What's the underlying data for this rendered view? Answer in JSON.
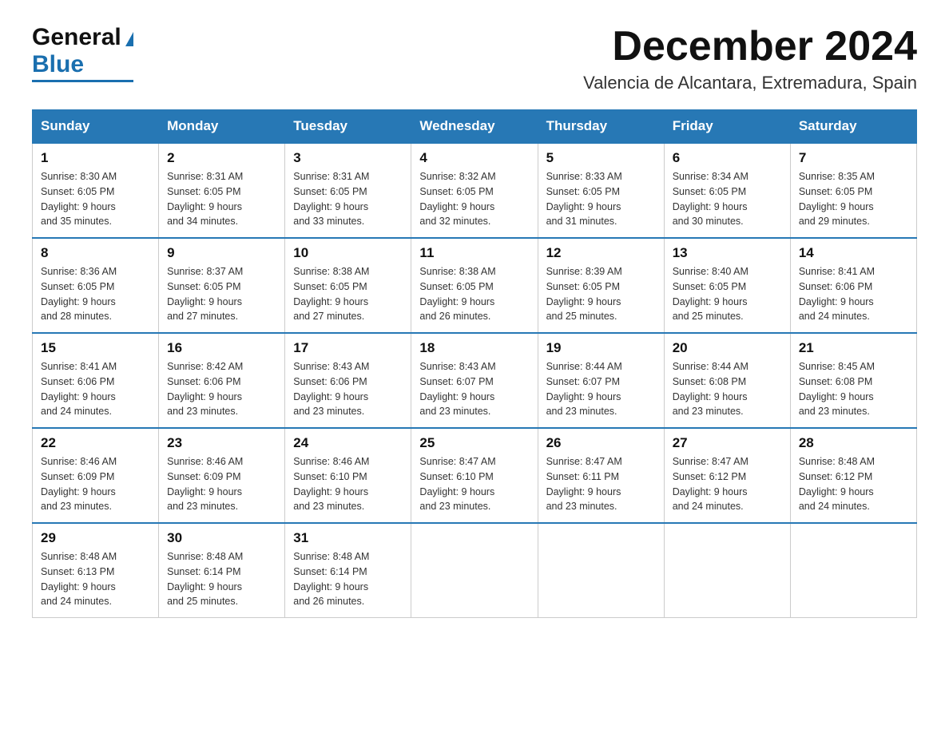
{
  "header": {
    "logo_general": "General",
    "logo_blue": "Blue",
    "month_title": "December 2024",
    "location": "Valencia de Alcantara, Extremadura, Spain"
  },
  "days_of_week": [
    "Sunday",
    "Monday",
    "Tuesday",
    "Wednesday",
    "Thursday",
    "Friday",
    "Saturday"
  ],
  "weeks": [
    [
      {
        "day": "1",
        "sunrise": "8:30 AM",
        "sunset": "6:05 PM",
        "daylight": "9 hours and 35 minutes."
      },
      {
        "day": "2",
        "sunrise": "8:31 AM",
        "sunset": "6:05 PM",
        "daylight": "9 hours and 34 minutes."
      },
      {
        "day": "3",
        "sunrise": "8:31 AM",
        "sunset": "6:05 PM",
        "daylight": "9 hours and 33 minutes."
      },
      {
        "day": "4",
        "sunrise": "8:32 AM",
        "sunset": "6:05 PM",
        "daylight": "9 hours and 32 minutes."
      },
      {
        "day": "5",
        "sunrise": "8:33 AM",
        "sunset": "6:05 PM",
        "daylight": "9 hours and 31 minutes."
      },
      {
        "day": "6",
        "sunrise": "8:34 AM",
        "sunset": "6:05 PM",
        "daylight": "9 hours and 30 minutes."
      },
      {
        "day": "7",
        "sunrise": "8:35 AM",
        "sunset": "6:05 PM",
        "daylight": "9 hours and 29 minutes."
      }
    ],
    [
      {
        "day": "8",
        "sunrise": "8:36 AM",
        "sunset": "6:05 PM",
        "daylight": "9 hours and 28 minutes."
      },
      {
        "day": "9",
        "sunrise": "8:37 AM",
        "sunset": "6:05 PM",
        "daylight": "9 hours and 27 minutes."
      },
      {
        "day": "10",
        "sunrise": "8:38 AM",
        "sunset": "6:05 PM",
        "daylight": "9 hours and 27 minutes."
      },
      {
        "day": "11",
        "sunrise": "8:38 AM",
        "sunset": "6:05 PM",
        "daylight": "9 hours and 26 minutes."
      },
      {
        "day": "12",
        "sunrise": "8:39 AM",
        "sunset": "6:05 PM",
        "daylight": "9 hours and 25 minutes."
      },
      {
        "day": "13",
        "sunrise": "8:40 AM",
        "sunset": "6:05 PM",
        "daylight": "9 hours and 25 minutes."
      },
      {
        "day": "14",
        "sunrise": "8:41 AM",
        "sunset": "6:06 PM",
        "daylight": "9 hours and 24 minutes."
      }
    ],
    [
      {
        "day": "15",
        "sunrise": "8:41 AM",
        "sunset": "6:06 PM",
        "daylight": "9 hours and 24 minutes."
      },
      {
        "day": "16",
        "sunrise": "8:42 AM",
        "sunset": "6:06 PM",
        "daylight": "9 hours and 23 minutes."
      },
      {
        "day": "17",
        "sunrise": "8:43 AM",
        "sunset": "6:06 PM",
        "daylight": "9 hours and 23 minutes."
      },
      {
        "day": "18",
        "sunrise": "8:43 AM",
        "sunset": "6:07 PM",
        "daylight": "9 hours and 23 minutes."
      },
      {
        "day": "19",
        "sunrise": "8:44 AM",
        "sunset": "6:07 PM",
        "daylight": "9 hours and 23 minutes."
      },
      {
        "day": "20",
        "sunrise": "8:44 AM",
        "sunset": "6:08 PM",
        "daylight": "9 hours and 23 minutes."
      },
      {
        "day": "21",
        "sunrise": "8:45 AM",
        "sunset": "6:08 PM",
        "daylight": "9 hours and 23 minutes."
      }
    ],
    [
      {
        "day": "22",
        "sunrise": "8:46 AM",
        "sunset": "6:09 PM",
        "daylight": "9 hours and 23 minutes."
      },
      {
        "day": "23",
        "sunrise": "8:46 AM",
        "sunset": "6:09 PM",
        "daylight": "9 hours and 23 minutes."
      },
      {
        "day": "24",
        "sunrise": "8:46 AM",
        "sunset": "6:10 PM",
        "daylight": "9 hours and 23 minutes."
      },
      {
        "day": "25",
        "sunrise": "8:47 AM",
        "sunset": "6:10 PM",
        "daylight": "9 hours and 23 minutes."
      },
      {
        "day": "26",
        "sunrise": "8:47 AM",
        "sunset": "6:11 PM",
        "daylight": "9 hours and 23 minutes."
      },
      {
        "day": "27",
        "sunrise": "8:47 AM",
        "sunset": "6:12 PM",
        "daylight": "9 hours and 24 minutes."
      },
      {
        "day": "28",
        "sunrise": "8:48 AM",
        "sunset": "6:12 PM",
        "daylight": "9 hours and 24 minutes."
      }
    ],
    [
      {
        "day": "29",
        "sunrise": "8:48 AM",
        "sunset": "6:13 PM",
        "daylight": "9 hours and 24 minutes."
      },
      {
        "day": "30",
        "sunrise": "8:48 AM",
        "sunset": "6:14 PM",
        "daylight": "9 hours and 25 minutes."
      },
      {
        "day": "31",
        "sunrise": "8:48 AM",
        "sunset": "6:14 PM",
        "daylight": "9 hours and 26 minutes."
      },
      null,
      null,
      null,
      null
    ]
  ],
  "labels": {
    "sunrise": "Sunrise:",
    "sunset": "Sunset:",
    "daylight": "Daylight:"
  }
}
